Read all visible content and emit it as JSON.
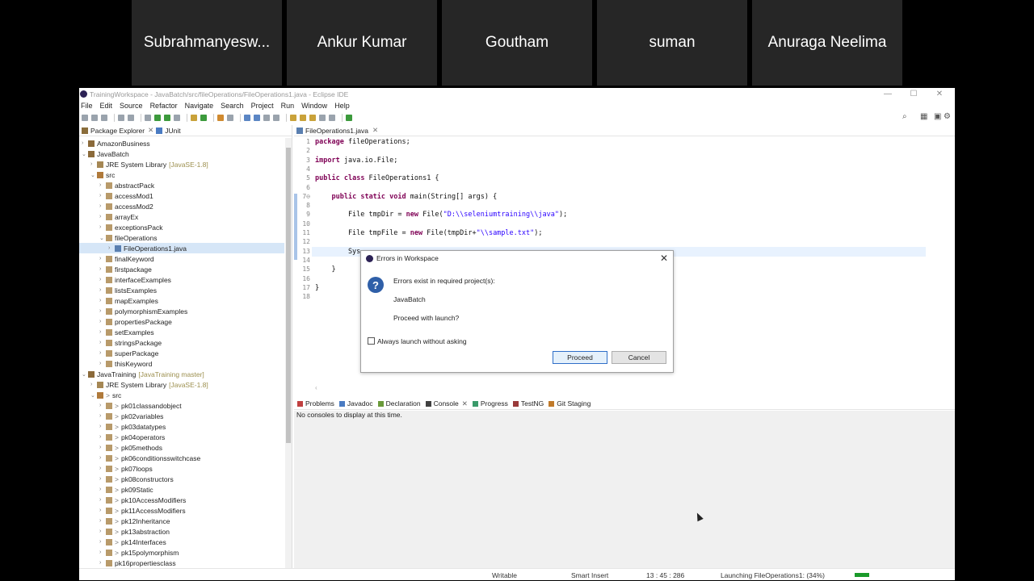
{
  "participants": [
    "Subrahmanyesw...",
    "Ankur Kumar",
    "Goutham",
    "suman",
    "Anuraga Neelima"
  ],
  "window": {
    "title": "TrainingWorkspace - JavaBatch/src/fileOperations/FileOperations1.java - Eclipse IDE",
    "controls": {
      "minimize": "—",
      "maximize": "☐",
      "close": "✕"
    }
  },
  "menu": [
    "File",
    "Edit",
    "Source",
    "Refactor",
    "Navigate",
    "Search",
    "Project",
    "Run",
    "Window",
    "Help"
  ],
  "left_panel": {
    "tabs": [
      {
        "label": "Package Explorer",
        "close": "✕"
      },
      {
        "label": "JUnit"
      }
    ],
    "tree": [
      {
        "label": "AmazonBusiness",
        "kind": "proj",
        "depth": 0,
        "arrow": "›"
      },
      {
        "label": "JavaBatch",
        "kind": "proj",
        "depth": 0,
        "arrow": "⌄"
      },
      {
        "label": "JRE System Library",
        "decor": "[JavaSE-1.8]",
        "kind": "lib",
        "depth": 1,
        "arrow": "›"
      },
      {
        "label": "src",
        "kind": "src",
        "depth": 1,
        "arrow": "⌄"
      },
      {
        "label": "abstractPack",
        "kind": "pkg",
        "depth": 2,
        "arrow": "›"
      },
      {
        "label": "accessMod1",
        "kind": "pkg",
        "depth": 2,
        "arrow": "›"
      },
      {
        "label": "accessMod2",
        "kind": "pkg",
        "depth": 2,
        "arrow": "›"
      },
      {
        "label": "arrayEx",
        "kind": "pkg",
        "depth": 2,
        "arrow": "›"
      },
      {
        "label": "exceptionsPack",
        "kind": "pkg",
        "depth": 2,
        "arrow": "›"
      },
      {
        "label": "fileOperations",
        "kind": "pkg",
        "depth": 2,
        "arrow": "⌄"
      },
      {
        "label": "FileOperations1.java",
        "kind": "java",
        "depth": 3,
        "arrow": "›",
        "selected": true
      },
      {
        "label": "finalKeyword",
        "kind": "pkg",
        "depth": 2,
        "arrow": "›"
      },
      {
        "label": "firstpackage",
        "kind": "pkg",
        "depth": 2,
        "arrow": "›"
      },
      {
        "label": "interfaceExamples",
        "kind": "pkg",
        "depth": 2,
        "arrow": "›"
      },
      {
        "label": "listsExamples",
        "kind": "pkg",
        "depth": 2,
        "arrow": "›"
      },
      {
        "label": "mapExamples",
        "kind": "pkg",
        "depth": 2,
        "arrow": "›"
      },
      {
        "label": "polymorphismExamples",
        "kind": "pkg",
        "depth": 2,
        "arrow": "›"
      },
      {
        "label": "propertiesPackage",
        "kind": "pkg",
        "depth": 2,
        "arrow": "›"
      },
      {
        "label": "setExamples",
        "kind": "pkg",
        "depth": 2,
        "arrow": "›"
      },
      {
        "label": "stringsPackage",
        "kind": "pkg",
        "depth": 2,
        "arrow": "›"
      },
      {
        "label": "superPackage",
        "kind": "pkg",
        "depth": 2,
        "arrow": "›"
      },
      {
        "label": "thisKeyword",
        "kind": "pkg",
        "depth": 2,
        "arrow": "›"
      },
      {
        "label": "JavaTraining",
        "decor": "[JavaTraining master]",
        "kind": "proj",
        "depth": 0,
        "arrow": "⌄"
      },
      {
        "label": "JRE System Library",
        "decor": "[JavaSE-1.8]",
        "kind": "lib",
        "depth": 1,
        "arrow": "›"
      },
      {
        "label": "src",
        "kind": "src",
        "depth": 1,
        "arrow": "⌄",
        "prefix": ">"
      },
      {
        "label": "pk01classandobject",
        "kind": "pkg",
        "depth": 2,
        "arrow": "›",
        "prefix": ">"
      },
      {
        "label": "pk02variables",
        "kind": "pkg",
        "depth": 2,
        "arrow": "›",
        "prefix": ">"
      },
      {
        "label": "pk03datatypes",
        "kind": "pkg",
        "depth": 2,
        "arrow": "›",
        "prefix": ">"
      },
      {
        "label": "pk04operators",
        "kind": "pkg",
        "depth": 2,
        "arrow": "›",
        "prefix": ">"
      },
      {
        "label": "pk05methods",
        "kind": "pkg",
        "depth": 2,
        "arrow": "›",
        "prefix": ">"
      },
      {
        "label": "pk06conditionsswitchcase",
        "kind": "pkg",
        "depth": 2,
        "arrow": "›",
        "prefix": ">"
      },
      {
        "label": "pk07loops",
        "kind": "pkg",
        "depth": 2,
        "arrow": "›",
        "prefix": ">"
      },
      {
        "label": "pk08constructors",
        "kind": "pkg",
        "depth": 2,
        "arrow": "›",
        "prefix": ">"
      },
      {
        "label": "pk09Static",
        "kind": "pkg",
        "depth": 2,
        "arrow": "›",
        "prefix": ">"
      },
      {
        "label": "pk10AccessModifiers",
        "kind": "pkg",
        "depth": 2,
        "arrow": "›",
        "prefix": ">"
      },
      {
        "label": "pk11AccessModifiers",
        "kind": "pkg",
        "depth": 2,
        "arrow": "›",
        "prefix": ">"
      },
      {
        "label": "pk12Inheritance",
        "kind": "pkg",
        "depth": 2,
        "arrow": "›",
        "prefix": ">"
      },
      {
        "label": "pk13abstraction",
        "kind": "pkg",
        "depth": 2,
        "arrow": "›",
        "prefix": ">"
      },
      {
        "label": "pk14Interfaces",
        "kind": "pkg",
        "depth": 2,
        "arrow": "›",
        "prefix": ">"
      },
      {
        "label": "pk15polymorphism",
        "kind": "pkg",
        "depth": 2,
        "arrow": "›",
        "prefix": ">"
      },
      {
        "label": "pk16propertiesclass",
        "kind": "pkg",
        "depth": 2,
        "arrow": "›"
      }
    ]
  },
  "editor": {
    "tab": {
      "label": "FileOperations1.java",
      "close": "✕"
    },
    "line_numbers": [
      "1",
      "2",
      "3",
      "4",
      "5",
      "6",
      "7⊖",
      "8",
      "9",
      "10",
      "11",
      "12",
      "13",
      "14",
      "15",
      "16",
      "17",
      "18"
    ],
    "code": [
      [
        {
          "t": "package",
          "k": "kw"
        },
        {
          "t": " fileOperations;"
        }
      ],
      [],
      [
        {
          "t": "import",
          "k": "kw"
        },
        {
          "t": " java.io.File;"
        }
      ],
      [],
      [
        {
          "t": "public",
          "k": "kw"
        },
        {
          "t": " "
        },
        {
          "t": "class",
          "k": "kw"
        },
        {
          "t": " FileOperations1 {"
        }
      ],
      [],
      [
        {
          "t": "    "
        },
        {
          "t": "public",
          "k": "kw"
        },
        {
          "t": " "
        },
        {
          "t": "static",
          "k": "kw"
        },
        {
          "t": " "
        },
        {
          "t": "void",
          "k": "kw"
        },
        {
          "t": " main(String[] args) {"
        }
      ],
      [],
      [
        {
          "t": "        File tmpDir = "
        },
        {
          "t": "new",
          "k": "kw"
        },
        {
          "t": " File("
        },
        {
          "t": "\"D:\\\\seleniumtraining\\\\java\"",
          "k": "str"
        },
        {
          "t": ");"
        }
      ],
      [],
      [
        {
          "t": "        File tmpFile = "
        },
        {
          "t": "new",
          "k": "kw"
        },
        {
          "t": " File(tmpDir+"
        },
        {
          "t": "\"\\\\sample.txt\"",
          "k": "str"
        },
        {
          "t": ");"
        }
      ],
      [],
      [
        {
          "t": "        Sys"
        }
      ],
      [],
      [
        {
          "t": "    }"
        }
      ],
      [],
      [
        {
          "t": "}"
        }
      ],
      []
    ]
  },
  "bottom_panel": {
    "tabs": [
      {
        "label": "Problems",
        "icon": "prb"
      },
      {
        "label": "Javadoc",
        "icon": "jd"
      },
      {
        "label": "Declaration",
        "icon": "dc"
      },
      {
        "label": "Console",
        "icon": "cn",
        "close": "✕"
      },
      {
        "label": "Progress",
        "icon": "pg"
      },
      {
        "label": "TestNG",
        "icon": "ng"
      },
      {
        "label": "Git Staging",
        "icon": "gs"
      }
    ],
    "console_message": "No consoles to display at this time."
  },
  "status_bar": {
    "writable": "Writable",
    "insert_mode": "Smart Insert",
    "position": "13 : 45 : 286",
    "task": "Launching FileOperations1: (34%)",
    "task_progress": 0.34
  },
  "dialog": {
    "title": "Errors in Workspace",
    "close": "✕",
    "icon_glyph": "?",
    "message": "Errors exist in required project(s):",
    "project": "JavaBatch",
    "question": "Proceed with launch?",
    "checkbox_label": "Always launch without asking",
    "checkbox_checked": false,
    "proceed_label": "Proceed",
    "cancel_label": "Cancel"
  }
}
